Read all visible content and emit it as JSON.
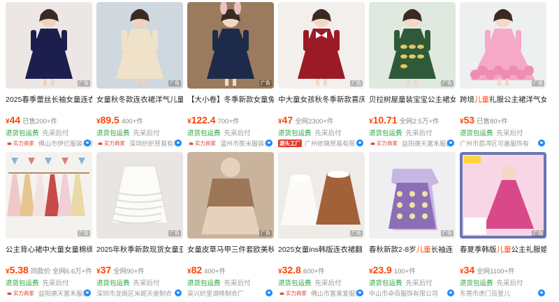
{
  "tags": {
    "return": "退货包运费",
    "after": "先采后付"
  },
  "badges": {
    "power": "实力商家",
    "source": "源头工厂"
  },
  "ad_mark": "广告",
  "products": [
    {
      "title": "2025春季蕾丝长袖女童连衣",
      "title_hl": "",
      "title_tail": "",
      "price": "44",
      "sold": "已售200+件",
      "badge": "power",
      "shop": "佛山市伊亿服装有限",
      "image": "navy-lace-dress"
    },
    {
      "title": "女童秋冬款连衣裙洋气儿童",
      "title_hl": "",
      "title_tail": "",
      "price": "89.5",
      "sold": "400+件",
      "badge": "power",
      "shop": "深圳织织贸易有限",
      "image": "beige-long-sleeve-dress"
    },
    {
      "title": "【大小卷】冬季新款女童兔",
      "title_hl": "",
      "title_tail": "",
      "price": "122.4",
      "sold": "700+件",
      "badge": "power",
      "shop": "温州市筱米服装有",
      "image": "navy-coat-bunny-ears"
    },
    {
      "title": "中大童女孩秋冬季新款喜庆",
      "title_hl": "",
      "title_tail": "",
      "price": "47",
      "sold": "全网2300+件",
      "badge": "source",
      "shop": "广州依锦贸易有限",
      "image": "red-bow-dress"
    },
    {
      "title": "贝拉树屋童装宝宝公主裙女",
      "title_hl": "",
      "title_tail": "",
      "price": "10.71",
      "sold": "全网2.5万+件",
      "badge": "power",
      "shop": "益阳德天富禾服装",
      "image": "leaf-print-dress"
    },
    {
      "title": "跨境",
      "title_hl": "儿童",
      "title_tail": "礼服公主裙洋气女",
      "price": "53",
      "sold": "已售80+件",
      "badge": "",
      "shop": "广州市荔湾区可嘉服饰有",
      "image": "pink-tulle-gown"
    },
    {
      "title": "公主背心裙中大童女童棉绸",
      "title_hl": "",
      "title_tail": "",
      "price": "5.38",
      "sold": "同款价 全网6.6万+件",
      "badge": "power",
      "shop": "益阳德天富禾服装",
      "image": "hanging-floral-dresses"
    },
    {
      "title": "2025年秋季新款现货女童亚",
      "title_hl": "",
      "title_tail": "",
      "price": "37",
      "sold": "全网90+件",
      "badge": "",
      "shop": "深圳市龙岗区米妮天使制衣",
      "image": "white-ruffle-dress"
    },
    {
      "title": "女童皮草马甲三件套欧美秋",
      "title_hl": "",
      "title_tail": "",
      "price": "82",
      "sold": "400+件",
      "badge": "",
      "shop": "吴兴织里湖哆制衣厂",
      "image": "tan-fur-vest-set"
    },
    {
      "title": "2025女童ins韩版连衣裙翻",
      "title_hl": "",
      "title_tail": "",
      "price": "32.8",
      "sold": "600+件",
      "badge": "power",
      "shop": "佛山市富莱爱服饰",
      "image": "peter-pan-collar-dresses"
    },
    {
      "title": "春秋新款2-8岁",
      "title_hl": "儿童",
      "title_tail": "长袖连",
      "price": "23.9",
      "sold": "100+件",
      "badge": "",
      "shop": "中山市卓佰服饰有限公司",
      "image": "purple-floral-dress"
    },
    {
      "title": "春夏季韩版",
      "title_hl": "儿童",
      "title_tail": "公主礼服婚",
      "price": "34",
      "sold": "全网1100+件",
      "badge": "",
      "shop": "东莞市虎门百登儿",
      "image": "rose-gown-ad"
    }
  ]
}
